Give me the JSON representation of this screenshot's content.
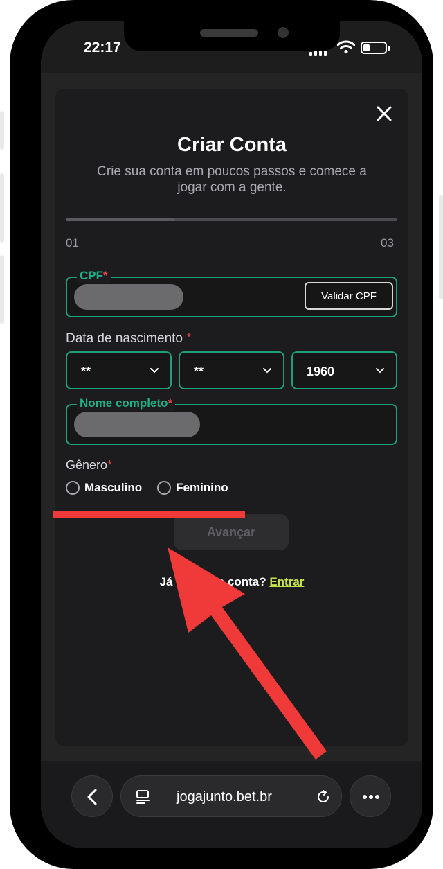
{
  "status_bar": {
    "time": "22:17",
    "battery_level": 0.3
  },
  "modal": {
    "title": "Criar Conta",
    "subtitle": "Crie sua conta em poucos passos e comece a jogar com a gente.",
    "progress": {
      "current_step": "01",
      "last_step": "03",
      "fraction": 0.33
    },
    "cpf": {
      "label": "CPF",
      "required_mark": "*",
      "validate_button": "Validar CPF"
    },
    "birth_date": {
      "label": "Data de nascimento",
      "required_mark": "*",
      "day": "**",
      "month": "**",
      "year": "1960"
    },
    "full_name": {
      "label": "Nome completo",
      "required_mark": "*"
    },
    "gender": {
      "label": "Gênero",
      "required_mark": "*",
      "options": [
        "Masculino",
        "Feminino"
      ]
    },
    "advance_button": "Avançar",
    "login_prompt": "Já tem uma conta?",
    "login_link": "Entrar"
  },
  "browser": {
    "url": "jogajunto.bet.br"
  },
  "colors": {
    "accent_green": "#1f9e79",
    "required_red": "#e8464e",
    "link_lime": "#c4e04a",
    "annotation_red": "#f03a3a"
  },
  "icons": [
    "close-icon",
    "chevron-down-icon",
    "back-arrow-icon",
    "tabs-icon",
    "reload-icon",
    "more-icon",
    "wifi-icon"
  ]
}
